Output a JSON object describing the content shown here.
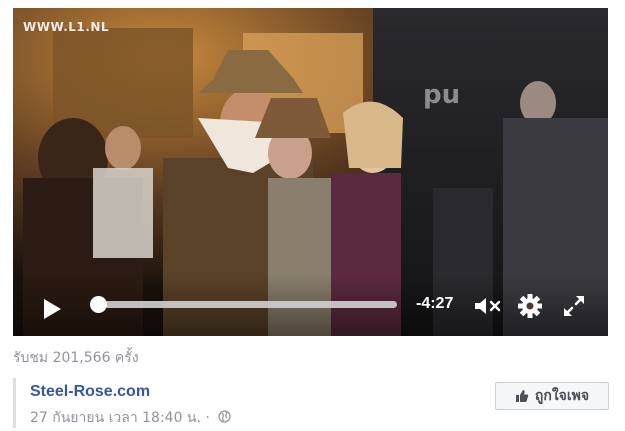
{
  "video": {
    "watermark": "WWW.L1.NL",
    "progress": 0.0,
    "time_remaining": "-4:27",
    "controls": {
      "play_icon": "play-icon",
      "mute_icon": "volume-muted-icon",
      "settings_icon": "gear-icon",
      "fullscreen_icon": "fullscreen-icon"
    }
  },
  "stats": {
    "views_text": "รับชม 201,566 ครั้ง"
  },
  "post": {
    "page_name": "Steel-Rose.com",
    "date_text": "27 กันยายน เวลา 18:40 น.",
    "separator": "·",
    "privacy_icon": "globe-icon",
    "like_button_label": "ถูกใจเพจ",
    "like_icon": "thumbs-up-icon"
  },
  "colors": {
    "link": "#365899",
    "meta": "#90949c",
    "button_bg": "#f6f7f9",
    "button_border": "#ced0d4"
  }
}
